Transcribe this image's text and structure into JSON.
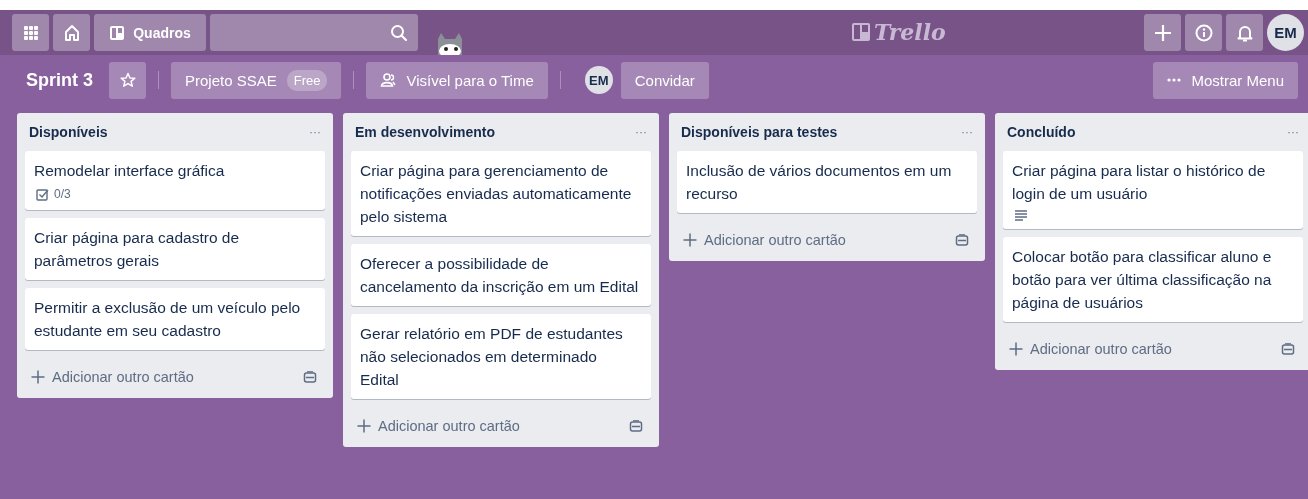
{
  "top_bar": {
    "boards_label": "Quadros",
    "logo": "Trello",
    "avatar": "EM"
  },
  "board_bar": {
    "title": "Sprint 3",
    "starred": false,
    "team": "Projeto SSAE",
    "plan_badge": "Free",
    "visibility": "Visível para o Time",
    "member": "EM",
    "invite": "Convidar",
    "menu": "Mostrar Menu"
  },
  "lists": [
    {
      "title": "Disponíveis",
      "menu": "···",
      "add_card": "Adicionar outro cartão",
      "cards": [
        {
          "title": "Remodelar interface gráfica",
          "badges": [
            {
              "kind": "checklist",
              "text": "0/3"
            }
          ]
        },
        {
          "title": "Criar página para cadastro de parâmetros gerais"
        },
        {
          "title": "Permitir a exclusão de um veículo pelo estudante em seu cadastro"
        }
      ]
    },
    {
      "title": "Em desenvolvimento",
      "menu": "···",
      "add_card": "Adicionar outro cartão",
      "cards": [
        {
          "title": "Criar página para gerenciamento de notificações enviadas automaticamente pelo sistema"
        },
        {
          "title": "Oferecer a possibilidade de cancelamento da inscrição em um Edital"
        },
        {
          "title": "Gerar relatório em PDF de estudantes não selecionados em determinado Edital"
        }
      ]
    },
    {
      "title": "Disponíveis para testes",
      "menu": "···",
      "add_card": "Adicionar outro cartão",
      "cards": [
        {
          "title": "Inclusão de vários documentos em um recurso"
        }
      ]
    },
    {
      "title": "Concluído",
      "menu": "···",
      "add_card": "Adicionar outro cartão",
      "cards": [
        {
          "title": "Criar página para listar o histórico de login de um usuário",
          "badges": [
            {
              "kind": "description"
            }
          ]
        },
        {
          "title": "Colocar botão para classificar aluno e botão para ver última classificação na página de usuários"
        }
      ]
    }
  ]
}
